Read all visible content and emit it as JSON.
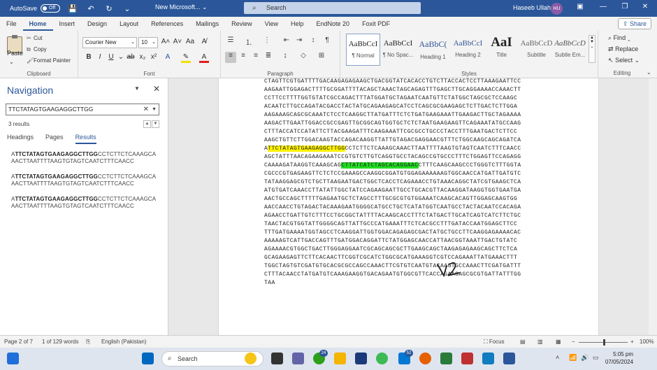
{
  "titlebar": {
    "autosave_label": "AutoSave",
    "autosave_state": "Off",
    "doc_title": "New Microsoft...",
    "search_placeholder": "Search",
    "user_name": "Haseeb Ullah",
    "user_initials": "HU"
  },
  "tabs": [
    "File",
    "Home",
    "Insert",
    "Design",
    "Layout",
    "References",
    "Mailings",
    "Review",
    "View",
    "Help",
    "EndNote 20",
    "Foxit PDF"
  ],
  "share_label": "Share",
  "clipboard": {
    "paste": "Paste",
    "cut": "Cut",
    "copy": "Copy",
    "format_painter": "Format Painter",
    "label": "Clipboard"
  },
  "font": {
    "family": "Courier New",
    "size": "10",
    "label": "Font"
  },
  "paragraph_label": "Paragraph",
  "styles": {
    "label": "Styles",
    "items": [
      {
        "preview": "AaBbCcI",
        "name": "¶ Normal"
      },
      {
        "preview": "AaBbCcI",
        "name": "¶ No Spac..."
      },
      {
        "preview": "AaBbC(",
        "name": "Heading 1"
      },
      {
        "preview": "AaBbCcI",
        "name": "Heading 2"
      },
      {
        "preview": "AaI",
        "name": "Title"
      },
      {
        "preview": "AaBbCcD",
        "name": "Subtitle"
      },
      {
        "preview": "AaBbCcD",
        "name": "Subtle Em..."
      }
    ]
  },
  "editing": {
    "find": "Find",
    "replace": "Replace",
    "select": "Select",
    "label": "Editing"
  },
  "navigation": {
    "title": "Navigation",
    "search_value": "TTCTATAGTGAAGAGGCTTGG",
    "results_count": "3 results",
    "tabs": [
      "Headings",
      "Pages",
      "Results"
    ],
    "results": [
      {
        "pre": "A",
        "match": "TTCTATAGTGAAGAGGCTTGG",
        "post": "CCTCTTCTCAAAGCA",
        "line2": "AACTTAATTTTAAGTGTAGTCAATCTTTCAACC"
      },
      {
        "pre": "A",
        "match": "TTCTATAGTGAAGAGGCTTGG",
        "post": "CCTCTTCTCAAAGCA",
        "line2": "AACTTAATTTTAAGTGTAGTCAATCTTTCAACC"
      },
      {
        "pre": "A",
        "match": "TTCTATAGTGAAGAGGCTTGG",
        "post": "CCTCTTCTCAAAGCA",
        "line2": "AACTTAATTTTAAGTGTAGTCAATCTTTCAACC"
      }
    ]
  },
  "document": {
    "lines": [
      "CTAGTTCGTGATTTTGACAAGAGAGAAGCTGACGGTATCACACCTGTCTTACCACTCCTTAAAGAATTCC",
      "AAGAATTGGAGACTTTTGCGGATTTTACAGCTAAACTAGCAGAGTTTGAGCTTGCAGGAAAACCAAACTT",
      "CCTTCCTTTTGGTGTATCGCCAGACTTTATGGATGCTAGAATCAATGTTCTATGGCTAGCGCTCCAAGC",
      "ACAATCTTGCCAGATACGACCTACTATGCAGAAGAGCATCCTCAGCGCGAAGAGCTCTTGACTCTTGGA",
      "AAGAAAGCAGCGCAAATCTCCTCAAGGCTTATGATTTCTCTGATGAAGAAATTGAAGACTTGCTAGAAAA",
      "AAGACTTGAATTGGACCGCCGAGTTGCGGCAGTGGTGCTCTCTAATGAAGAAGTTCAGAAATATGCCAAG",
      "CTTTACCATCCATATTCTTACGAAGATTTCAAGAAATTCGCGCCTGCCCTACCTTTGAATGACTCTTCC",
      "AAGCTGTTCTTGGACAAGTACCAGACAAGGTTATTGTAGACGAGGAACGTTTCTGGCAAGCAGCAGATCA"
    ],
    "hl_line_pre": "A",
    "hl_yellow": "TTCTATAGTGAAGAGGCTTGG",
    "hl_line_post": "CCTCTTCTCAAAGCAAACTTAATTTTAAGTGTAGTCAATCTTTCAACC",
    "line10_pre": "AGCTATTTAACAGAAGAAATCCGTGTCTTGTCAGGTGCCTACAGCCGTGCCCTTTCTGGAGTTCCAGAGG",
    "line11_pre": "CAAAAGATAAGGTCAAAGCAG",
    "hl_green": "CTTATCATCTAGCACAGGAAC",
    "line11_post": "CTTTCAAGCAAGCCCTGGGTCTTTGGTA",
    "lines_after": [
      "CGCCCGTGAGAAGTTCTCTCCGAAAGCCAAGGCGGATGTGGAGAAAAAAGTGGCAACCATGATTGATGTC",
      "TATAAGGAGCGTCTGCTTAAGAATGACTGGCTCACCTCAGAAACCTGTAAACAGGCTATCGTGAAGCTCA",
      "ATGTGATCAAACCTTATATTGGCTATCCAGAAGAATTGCCTGCACGTTACAAGGATAAGGTGGTGAATGA",
      "AACTGCCAGCTTTTTGAGAATGCTCTAGCCTTTGCGCGTGTGGAAATCAAGCACAGTTGGAGCAAGTGG",
      "AACCAACCTGTAGACTACAAAGAATGGGGCATGCCTGCTCATATGGTCAATGCCTACTACAATCCACAGA",
      "AGAACCTGATTGTCTTTCCTGCGGCTATTTTACAAGCACCTTTCTATGACTTGCATCAGTCATCTTCTGC",
      "TAACTACGTGGTATTGGGGCAGTTATTGCCCATGAAATTTCTCACGCCTTTGATACCAATGGAGCTTCC",
      "TTTGATGAAAATGGTAGCCTCAAGGATTGGTGGACAGAGAGCGACTATGCTGCCTTCAAGGAGAAAACAC",
      "AAAAAGTCATTGACCAGTTTGATGGACAGGATTCTATGGAGCAACCATTAACGGTAAATTGACTGTATC",
      "AGAAAACGTGGCTGACTTGGGAGGAATCGCAGCAGCGCTTGAAGCAGCTAAGAGAGAAGCAGCTTCTCA",
      "GCAGAAGAGTTCTTCACAACTTCGGTCGCATCTGGCGCATGAAAGGTCGTCCAGAAATTATGAAACTTT",
      "TGGCTAGTGTCGATGTGCACGCGCCAGCCAAACTTCGTGTCAATGTACAAGTGCCAAACTTCGATGATTT",
      "CTTTACAACCTATGATGTCAAAGAAGGTGACAGAATGTGGCGTTCACCAGAAGAGCGCGTGATTATTTGG",
      "TAA"
    ]
  },
  "status": {
    "page": "Page 2 of 7",
    "words": "1 of 129 words",
    "language": "English (Pakistan)",
    "focus": "Focus",
    "zoom": "100%"
  },
  "taskbar": {
    "search": "Search",
    "badge1": "24",
    "badge2": "52",
    "time": "5:05 pm",
    "date": "07/05/2024"
  }
}
